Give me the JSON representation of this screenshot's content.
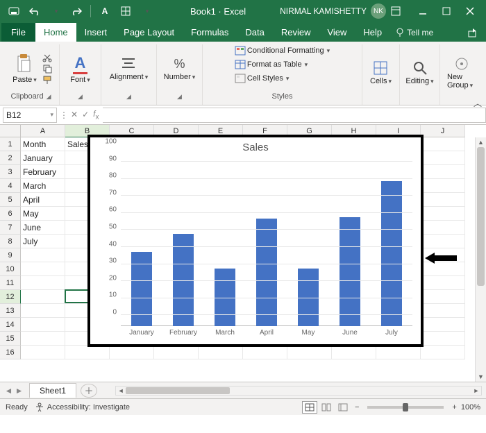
{
  "titlebar": {
    "title": "Book1 · Excel",
    "user_name": "NIRMAL KAMISHETTY",
    "user_initials": "NK"
  },
  "tabs": {
    "file": "File",
    "list": [
      "Home",
      "Insert",
      "Page Layout",
      "Formulas",
      "Data",
      "Review",
      "View",
      "Help"
    ],
    "active": "Home",
    "tellme": "Tell me"
  },
  "ribbon": {
    "clipboard": {
      "paste": "Paste",
      "label": "Clipboard"
    },
    "font": {
      "btn": "Font",
      "label": "Font"
    },
    "alignment": {
      "btn": "Alignment",
      "label": "Alignment"
    },
    "number": {
      "btn": "Number",
      "label": "Number"
    },
    "styles": {
      "cond": "Conditional Formatting",
      "fmt": "Format as Table",
      "cell": "Cell Styles",
      "label": "Styles"
    },
    "cells": {
      "btn": "Cells",
      "label": "Cells"
    },
    "editing": {
      "btn": "Editing",
      "label": "Editing"
    },
    "newgroup": {
      "btn": "New Group",
      "label": ""
    }
  },
  "namebox": "B12",
  "columns": [
    "A",
    "B",
    "C",
    "D",
    "E",
    "F",
    "G",
    "H",
    "I",
    "J"
  ],
  "rows": [
    "1",
    "2",
    "3",
    "4",
    "5",
    "6",
    "7",
    "8",
    "9",
    "10",
    "11",
    "12",
    "13",
    "14",
    "15",
    "16"
  ],
  "sheet_a": [
    "Month",
    "January",
    "February",
    "March",
    "April",
    "May",
    "June",
    "July",
    "",
    "",
    "",
    "",
    "",
    "",
    "",
    ""
  ],
  "sheet_b": [
    "Sales",
    "",
    "",
    "",
    "",
    "",
    "",
    "",
    "",
    "",
    "",
    "",
    "",
    "",
    "",
    ""
  ],
  "active_cell": {
    "row": 12,
    "col": "B"
  },
  "sheet_tabs": {
    "active": "Sheet1"
  },
  "status": {
    "ready": "Ready",
    "acc": "Accessibility: Investigate",
    "zoom": "100%"
  },
  "chart_data": {
    "type": "bar",
    "title": "Sales",
    "categories": [
      "January",
      "February",
      "March",
      "April",
      "May",
      "June",
      "July"
    ],
    "values": [
      45,
      56,
      35,
      65,
      35,
      66,
      88
    ],
    "ylim": [
      0,
      100
    ],
    "ystep": 10,
    "xlabel": "",
    "ylabel": ""
  }
}
